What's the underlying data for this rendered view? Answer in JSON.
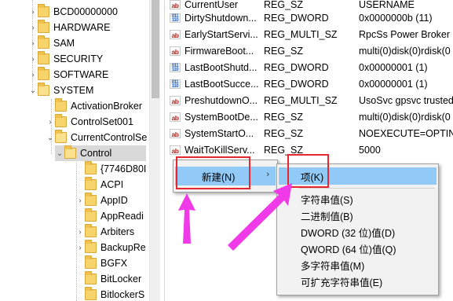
{
  "tree": {
    "items": [
      {
        "label": "BCD00000000"
      },
      {
        "label": "HARDWARE"
      },
      {
        "label": "SAM"
      },
      {
        "label": "SECURITY"
      },
      {
        "label": "SOFTWARE"
      },
      {
        "label": "SYSTEM"
      },
      {
        "label": "ActivationBroker"
      },
      {
        "label": "ControlSet001"
      },
      {
        "label": "CurrentControlSe"
      },
      {
        "label": "Control"
      },
      {
        "label": "{7746D80I"
      },
      {
        "label": "ACPI"
      },
      {
        "label": "AppID"
      },
      {
        "label": "AppReadi"
      },
      {
        "label": "Arbiters"
      },
      {
        "label": "BackupRe"
      },
      {
        "label": "BGFX"
      },
      {
        "label": "BitLocker"
      },
      {
        "label": "BitlockerS"
      }
    ]
  },
  "values": {
    "rows": [
      {
        "icon": "ab",
        "name": "CurrentUser",
        "type": "REG_SZ",
        "data": "USERNAME"
      },
      {
        "icon": "bin",
        "name": "DirtyShutdown...",
        "type": "REG_DWORD",
        "data": "0x0000000b (11)"
      },
      {
        "icon": "ab",
        "name": "EarlyStartServi...",
        "type": "REG_MULTI_SZ",
        "data": "RpcSs Power Broker"
      },
      {
        "icon": "ab",
        "name": "FirmwareBoot...",
        "type": "REG_SZ",
        "data": "multi(0)disk(0)rdisk(0"
      },
      {
        "icon": "bin",
        "name": "LastBootShutd...",
        "type": "REG_DWORD",
        "data": "0x00000001 (1)"
      },
      {
        "icon": "bin",
        "name": "LastBootSucce...",
        "type": "REG_DWORD",
        "data": "0x00000001 (1)"
      },
      {
        "icon": "ab",
        "name": "PreshutdownO...",
        "type": "REG_MULTI_SZ",
        "data": "UsoSvc gpsvc trusted"
      },
      {
        "icon": "ab",
        "name": "SystemBootDe...",
        "type": "REG_SZ",
        "data": "multi(0)disk(0)rdisk(0"
      },
      {
        "icon": "ab",
        "name": "SystemStartO...",
        "type": "REG_SZ",
        "data": " NOEXECUTE=OPTIN"
      },
      {
        "icon": "ab",
        "name": "WaitToKillServ...",
        "type": "REG_SZ",
        "data": "5000"
      }
    ]
  },
  "context_menu": {
    "new_label": "新建(N)",
    "submenu_arrow": "›"
  },
  "submenu": {
    "items": [
      {
        "label": "项(K)"
      },
      {
        "label": "字符串值(S)"
      },
      {
        "label": "二进制值(B)"
      },
      {
        "label": "DWORD (32 位)值(D)"
      },
      {
        "label": "QWORD (64 位)值(Q)"
      },
      {
        "label": "多字符串值(M)"
      },
      {
        "label": "可扩充字符串值(E)"
      }
    ]
  },
  "colors": {
    "highlight": "#91c9f7",
    "annotation_red": "#e8262e",
    "annotation_arrow": "#f03ae8"
  }
}
